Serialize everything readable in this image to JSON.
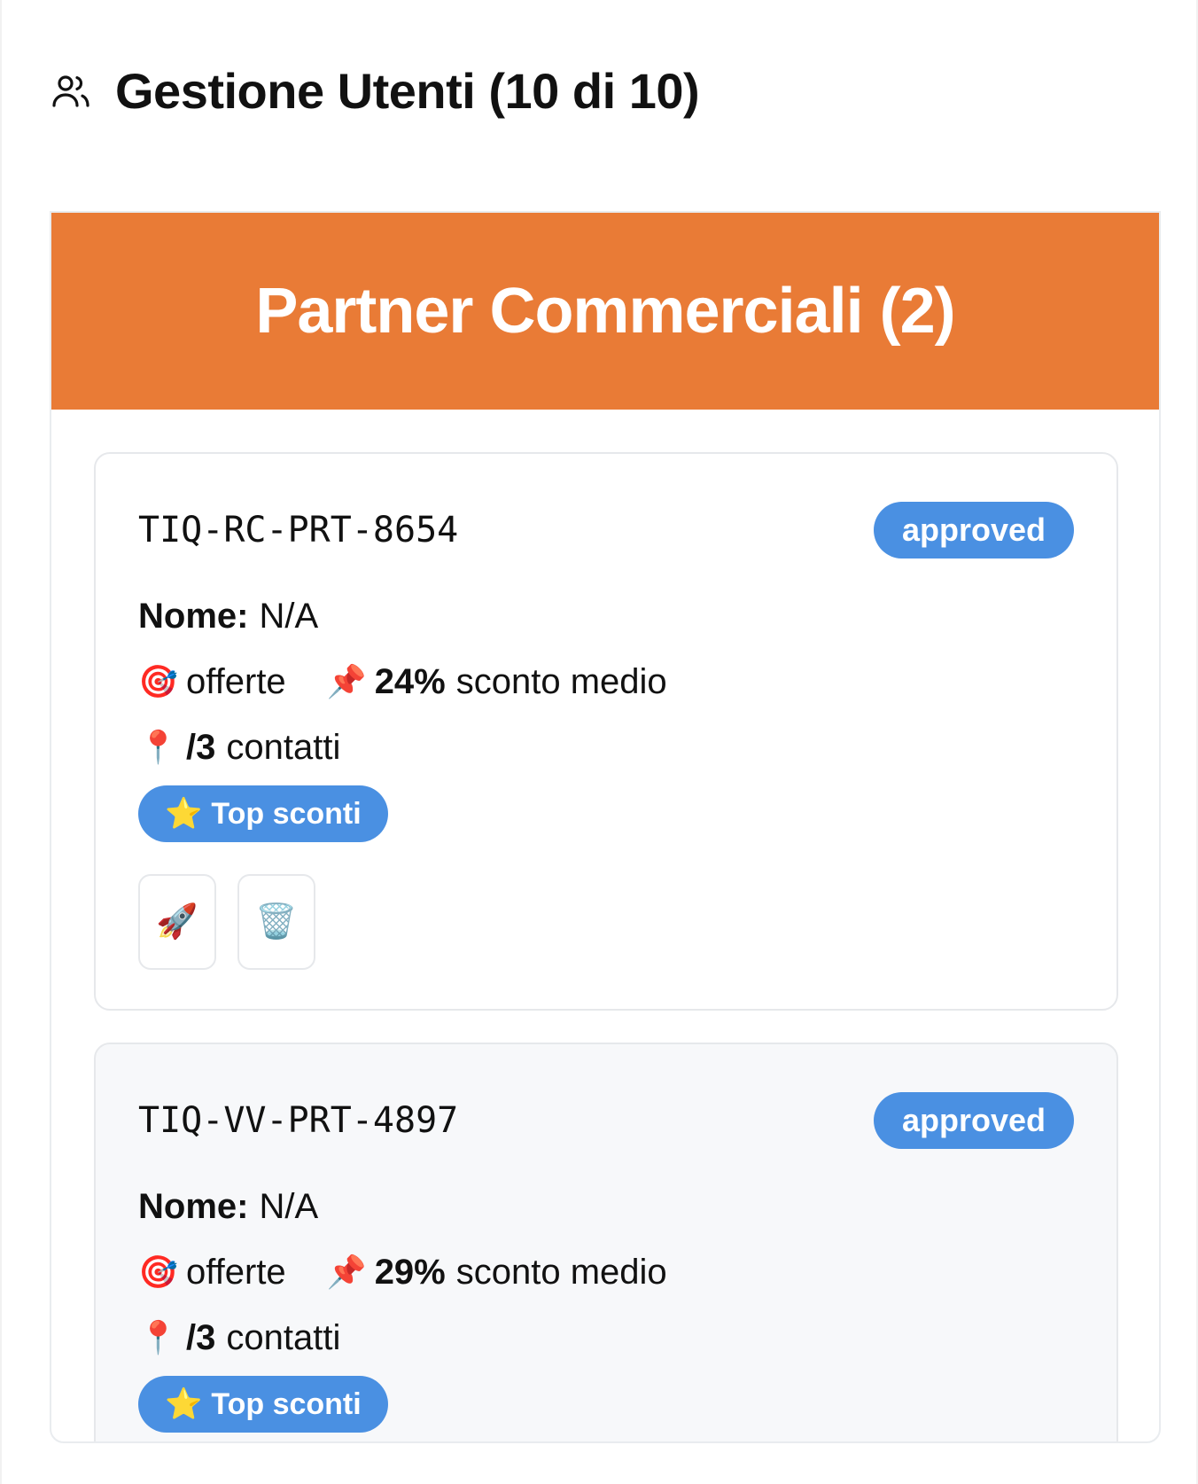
{
  "header": {
    "icon": "users-icon",
    "title": "Gestione Utenti (10 di 10)"
  },
  "section": {
    "title": "Partner Commerciali (2)",
    "color": "#e97b36"
  },
  "cards": [
    {
      "code": "TIQ-RC-PRT-8654",
      "status": "approved",
      "name_label": "Nome:",
      "name_value": "N/A",
      "offers_icon": "🎯",
      "offers_label": "offerte",
      "discount_icon": "📌",
      "discount_value": "24%",
      "discount_label": "sconto medio",
      "contacts_icon": "📍",
      "contacts_value": "/3",
      "contacts_label": "contatti",
      "tag_icon": "⭐",
      "tag_label": "Top sconti",
      "actions": [
        {
          "icon": "🚀",
          "name": "rocket-icon"
        },
        {
          "icon": "🗑️",
          "name": "trash-icon"
        }
      ]
    },
    {
      "code": "TIQ-VV-PRT-4897",
      "status": "approved",
      "name_label": "Nome:",
      "name_value": "N/A",
      "offers_icon": "🎯",
      "offers_label": "offerte",
      "discount_icon": "📌",
      "discount_value": "29%",
      "discount_label": "sconto medio",
      "contacts_icon": "📍",
      "contacts_value": "/3",
      "contacts_label": "contatti",
      "tag_icon": "⭐",
      "tag_label": "Top sconti"
    }
  ],
  "colors": {
    "accent": "#4a90e2",
    "section_header": "#e97b36"
  }
}
